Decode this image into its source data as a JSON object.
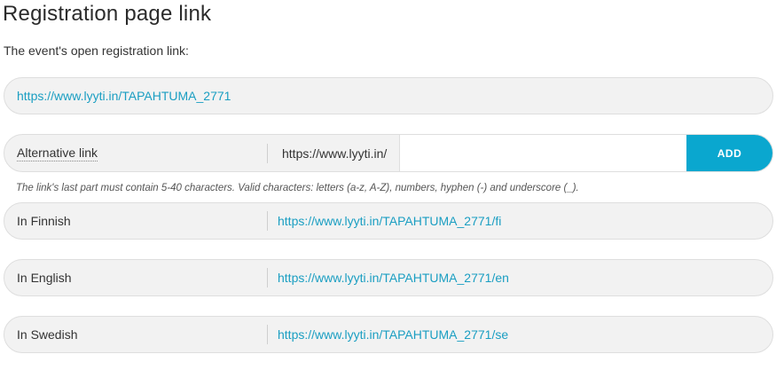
{
  "header": {
    "title": "Registration page link",
    "subtitle": "The event's open registration link:"
  },
  "main_link": {
    "url": "https://www.lyyti.in/TAPAHTUMA_2771"
  },
  "alternative": {
    "label": "Alternative link",
    "prefix": "https://www.lyyti.in/",
    "value": "",
    "button_label": "ADD"
  },
  "hint": "The link's last part must contain 5-40 characters. Valid characters: letters (a-z, A-Z), numbers, hyphen (-) and underscore (_).",
  "languages": [
    {
      "label": "In Finnish",
      "url": "https://www.lyyti.in/TAPAHTUMA_2771/fi"
    },
    {
      "label": "In English",
      "url": "https://www.lyyti.in/TAPAHTUMA_2771/en"
    },
    {
      "label": "In Swedish",
      "url": "https://www.lyyti.in/TAPAHTUMA_2771/se"
    }
  ],
  "colors": {
    "link": "#1a9ec2",
    "button": "#0aa7cf",
    "row_background": "#f2f2f2"
  }
}
